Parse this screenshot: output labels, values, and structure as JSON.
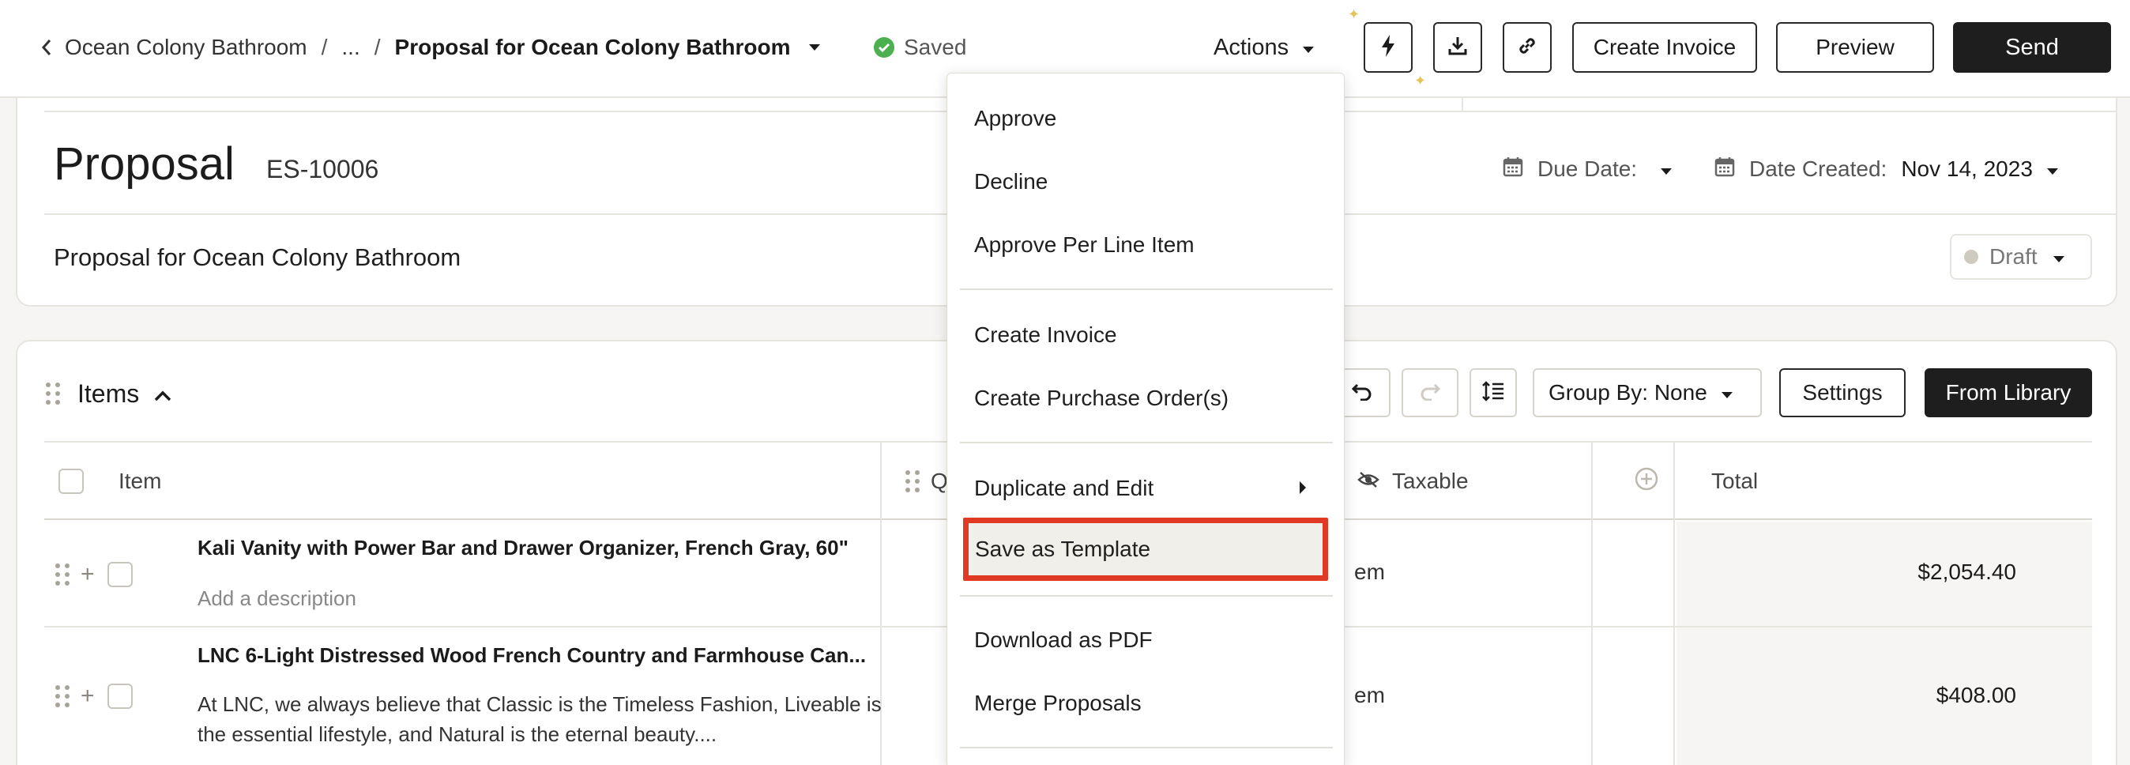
{
  "breadcrumb": {
    "root": "Ocean Colony Bathroom",
    "ellipsis": "...",
    "current": "Proposal for Ocean Colony Bathroom"
  },
  "status": {
    "saved_label": "Saved",
    "saved_color": "#4caf50"
  },
  "header": {
    "actions_label": "Actions",
    "create_invoice_label": "Create Invoice",
    "preview_label": "Preview",
    "send_label": "Send",
    "icons": [
      "lightning-icon",
      "download-icon",
      "link-icon"
    ]
  },
  "proposal": {
    "title": "Proposal",
    "number": "ES-10006",
    "due_date_label": "Due Date:",
    "due_date_value": "",
    "date_created_label": "Date Created:",
    "date_created_value": "Nov 14, 2023",
    "name": "Proposal for Ocean Colony Bathroom",
    "status": "Draft"
  },
  "items_section": {
    "title": "Items",
    "group_by_label": "Group By: None",
    "settings_label": "Settings",
    "library_label": "From Library",
    "columns": {
      "item": "Item",
      "qty": "Qt",
      "taxable": "Taxable",
      "total": "Total"
    },
    "rows": [
      {
        "name": "Kali Vanity with Power Bar and Drawer Organizer, French Gray, 60\"",
        "description": "Add a description",
        "taxable_fragment": "em",
        "total": "$2,054.40"
      },
      {
        "name": "LNC 6-Light Distressed Wood French Country and Farmhouse Can...",
        "description": "At LNC, we always believe that Classic is the Timeless Fashion, Liveable is the essential lifestyle, and Natural is the eternal beauty....",
        "taxable_fragment": "em",
        "total": "$408.00"
      }
    ]
  },
  "actions_menu": {
    "items": [
      "Approve",
      "Decline",
      "Approve Per Line Item",
      "Create Invoice",
      "Create Purchase Order(s)",
      "Duplicate and Edit",
      "Save as Template",
      "Download as PDF",
      "Merge Proposals"
    ],
    "highlighted": "Save as Template",
    "highlight_color": "#e03a25"
  }
}
